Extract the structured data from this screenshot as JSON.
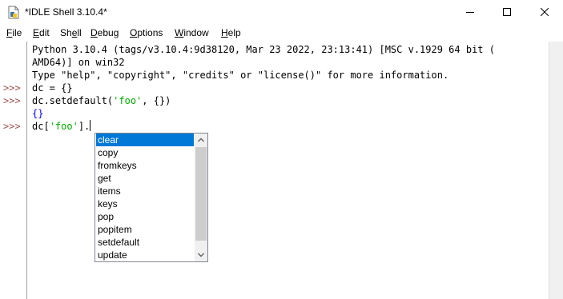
{
  "window": {
    "title": "*IDLE Shell 3.10.4*"
  },
  "menu": {
    "items": [
      "File",
      "Edit",
      "Shell",
      "Debug",
      "Options",
      "Window",
      "Help"
    ]
  },
  "shell": {
    "prompt": ">>>",
    "banner_line1": "Python 3.10.4 (tags/v3.10.4:9d38120, Mar 23 2022, 23:13:41) [MSC v.1929 64 bit (",
    "banner_line2": "AMD64)] on win32",
    "banner_line3": "Type \"help\", \"copyright\", \"credits\" or \"license()\" for more information.",
    "line4": "dc = {}",
    "line5_pre": "dc.setdefault(",
    "line5_str": "'foo'",
    "line5_post": ", {})",
    "output6": "{}",
    "line7_pre": "dc[",
    "line7_str": "'foo'",
    "line7_post": "]."
  },
  "autocomplete": {
    "selected": "clear",
    "items": [
      "clear",
      "copy",
      "fromkeys",
      "get",
      "items",
      "keys",
      "pop",
      "popitem",
      "setdefault",
      "update"
    ]
  },
  "colors": {
    "prompt": "#a05050",
    "string": "#00aa00",
    "output": "#0000ff",
    "selection": "#0078d7"
  }
}
